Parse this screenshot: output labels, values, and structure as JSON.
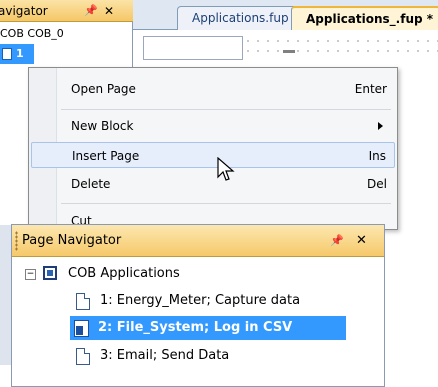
{
  "background_navigator": {
    "title": "avigator",
    "pin": "❀",
    "close": "✕",
    "root": "COB COB_0",
    "selected_number": "1"
  },
  "editor": {
    "tabs": [
      {
        "label": "Applications.fup"
      },
      {
        "label": "Applications_.fup *"
      }
    ]
  },
  "context_menu": {
    "items": [
      {
        "label": "Open Page",
        "shortcut": "Enter"
      },
      {
        "label": "New Block",
        "shortcut": ""
      },
      {
        "label": "Insert Page",
        "shortcut": "Ins"
      },
      {
        "label": "Delete",
        "shortcut": "Del"
      },
      {
        "label": "Cut",
        "shortcut": ""
      }
    ]
  },
  "page_navigator": {
    "title": "Page Navigator",
    "pin": "❀",
    "close": "✕",
    "root": {
      "label": "COB Applications",
      "expander": "−"
    },
    "pages": [
      {
        "label": "1: Energy_Meter; Capture data"
      },
      {
        "label": "2: File_System; Log in CSV"
      },
      {
        "label": "3: Email; Send Data"
      }
    ]
  },
  "colors": {
    "selection": "#3399ff",
    "header_gold": "#f6c96a",
    "menu_highlight": "#e6eefb"
  }
}
